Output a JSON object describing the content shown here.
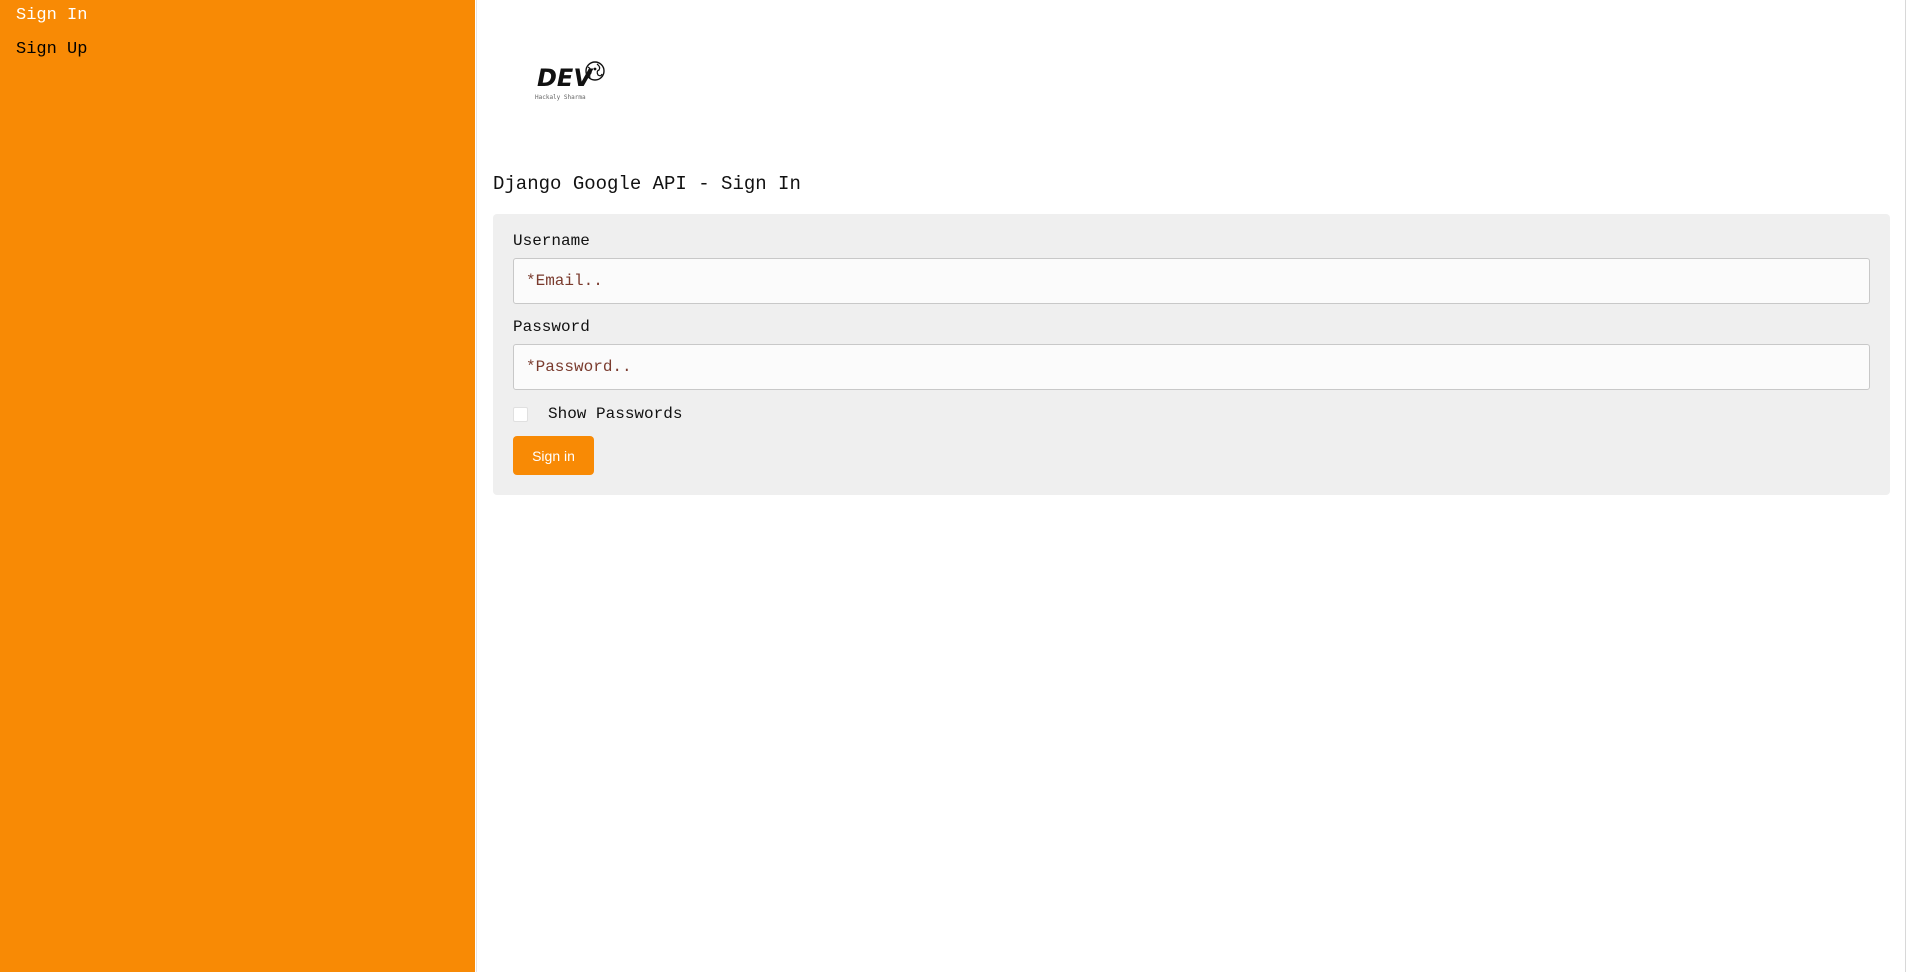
{
  "sidebar": {
    "items": [
      {
        "label": "Sign In"
      },
      {
        "label": "Sign Up"
      }
    ]
  },
  "logo": {
    "text": "DEV",
    "subtext": "Hackaly Sharma"
  },
  "page": {
    "title": "Django Google API - Sign In"
  },
  "form": {
    "username_label": "Username",
    "username_placeholder": "*Email..",
    "username_value": "",
    "password_label": "Password",
    "password_placeholder": "*Password..",
    "password_value": "",
    "show_passwords_label": "Show Passwords",
    "show_passwords_checked": false,
    "submit_label": "Sign in"
  },
  "colors": {
    "accent": "#f88a05",
    "card_background": "#efefef",
    "placeholder": "#7a3b2e"
  },
  "icons": {
    "logo": "dev-logo-icon",
    "globe": "globe-icon"
  }
}
